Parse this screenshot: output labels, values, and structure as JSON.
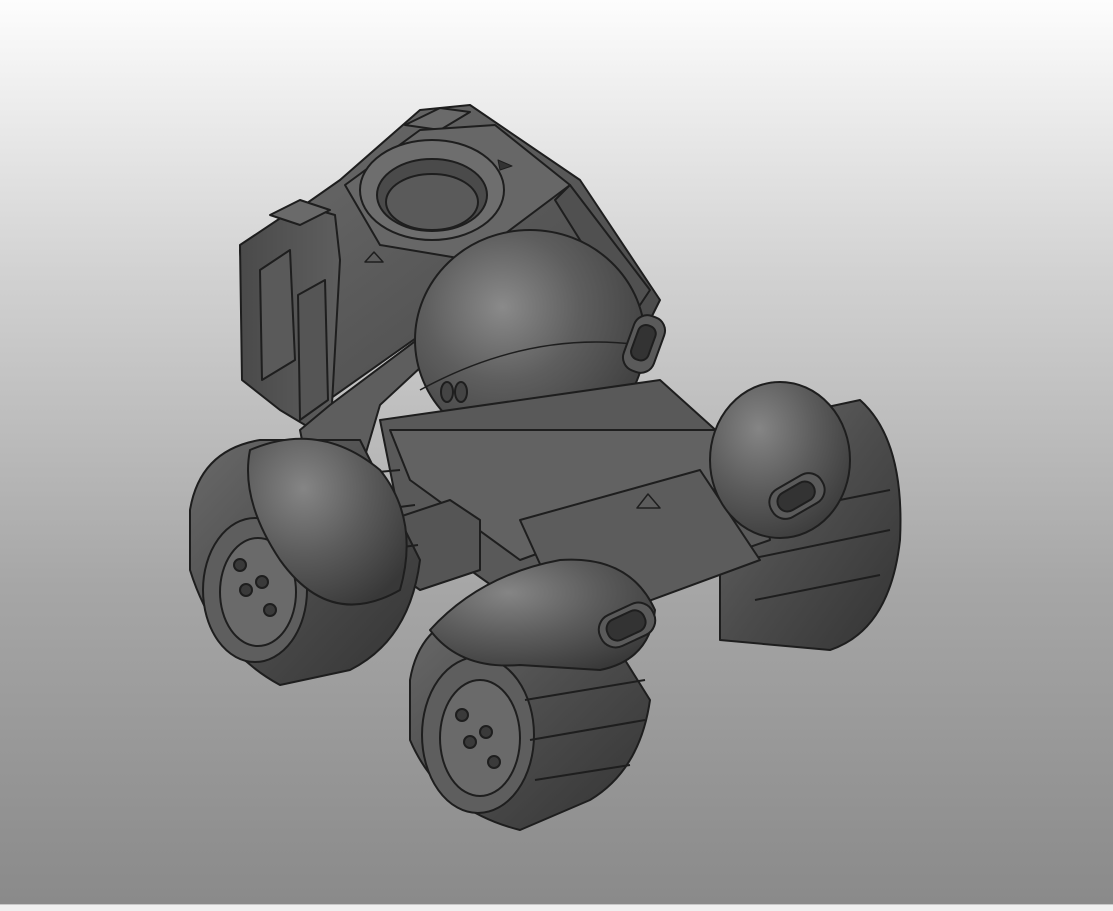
{
  "viewport": {
    "shading": "shaded",
    "background_top": "#fdfdfd",
    "background_bottom": "#8a8a8a"
  },
  "model": {
    "icon": "rover-robot-model",
    "body_color": "#5a5a5a",
    "edge_color": "#1e1e1e"
  }
}
